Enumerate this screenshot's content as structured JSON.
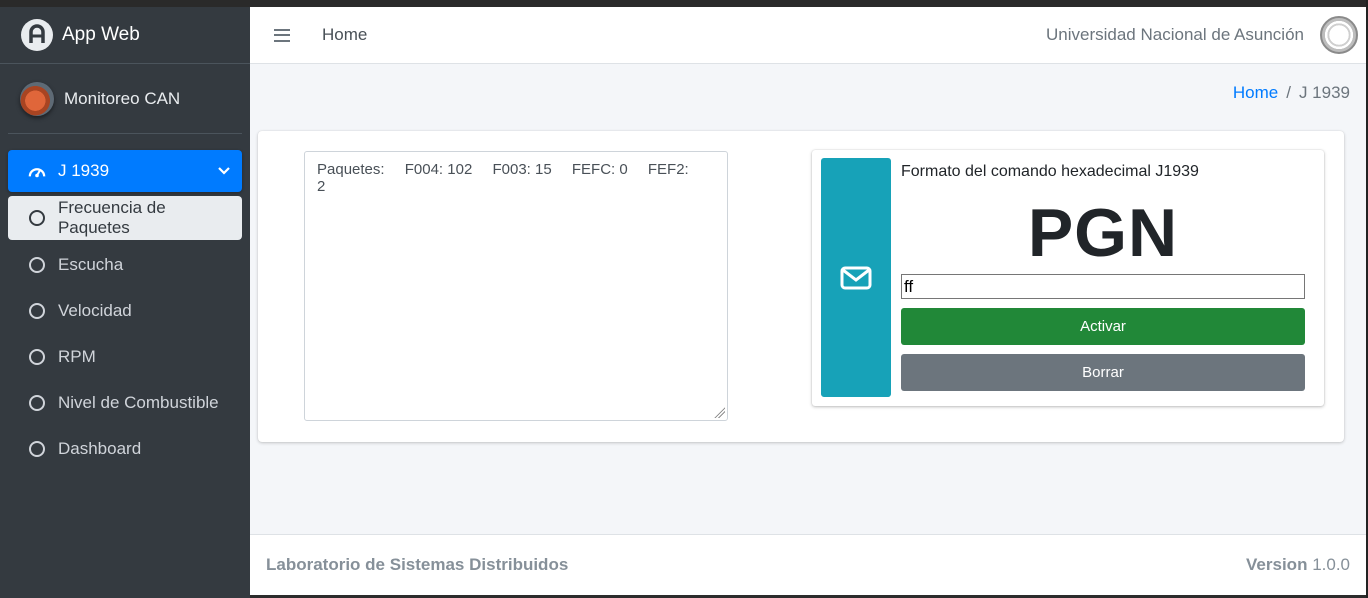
{
  "brand": {
    "title": "App Web",
    "logo_icon": "app-logo-icon"
  },
  "user": {
    "name": "Monitoreo CAN",
    "avatar_icon": "truck-avatar-icon"
  },
  "sidebar": {
    "group": {
      "label": "J 1939",
      "icon": "tachometer-icon"
    },
    "items": [
      {
        "label": "Frecuencia de Paquetes"
      },
      {
        "label": "Escucha"
      },
      {
        "label": "Velocidad"
      },
      {
        "label": "RPM"
      },
      {
        "label": "Nivel de Combustible"
      },
      {
        "label": "Dashboard"
      }
    ]
  },
  "topbar": {
    "home": "Home",
    "university": "Universidad Nacional de Asunción",
    "seal_icon": "university-seal-icon"
  },
  "breadcrumb": {
    "home": "Home",
    "separator": "/",
    "current": "J 1939"
  },
  "packets": {
    "prefix": "Paquetes:",
    "items": [
      "F004: 102",
      "F003: 15",
      "FEFC: 0",
      "FEF2: 2"
    ]
  },
  "command": {
    "title": "Formato del comando hexadecimal J1939",
    "big_text": "PGN",
    "input_value": "ff",
    "activate_label": "Activar",
    "clear_label": "Borrar",
    "icon": "envelope-icon",
    "colors": {
      "info": "#17a2b8",
      "success": "#218838",
      "secondary": "#6c757d"
    }
  },
  "footer": {
    "lab": "Laboratorio de Sistemas Distribuidos",
    "version_label": "Version",
    "version": "1.0.0"
  },
  "colors": {
    "sidebar": "#343a40",
    "primary": "#007bff",
    "content_bg": "#f4f6f9"
  }
}
